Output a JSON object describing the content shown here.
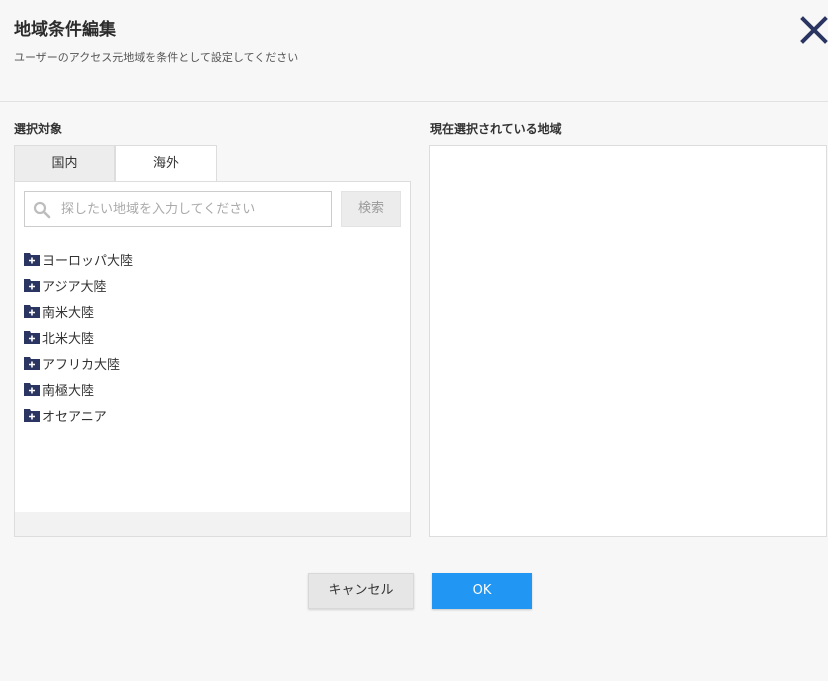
{
  "dialog": {
    "title": "地域条件編集",
    "subtitle": "ユーザーのアクセス元地域を条件として設定してください",
    "close_icon": "close-icon"
  },
  "left": {
    "label": "選択対象",
    "tabs": [
      {
        "label": "国内",
        "active": false
      },
      {
        "label": "海外",
        "active": true
      }
    ],
    "search": {
      "placeholder": "探したい地域を入力してください",
      "value": "",
      "button_label": "検索"
    },
    "tree": [
      {
        "label": "ヨーロッパ大陸",
        "icon": "folder-plus-icon"
      },
      {
        "label": "アジア大陸",
        "icon": "folder-plus-icon"
      },
      {
        "label": "南米大陸",
        "icon": "folder-plus-icon"
      },
      {
        "label": "北米大陸",
        "icon": "folder-plus-icon"
      },
      {
        "label": "アフリカ大陸",
        "icon": "folder-plus-icon"
      },
      {
        "label": "南極大陸",
        "icon": "folder-plus-icon"
      },
      {
        "label": "オセアニア",
        "icon": "folder-plus-icon"
      }
    ]
  },
  "right": {
    "label": "現在選択されている地域",
    "selected": []
  },
  "footer": {
    "cancel_label": "キャンセル",
    "ok_label": "OK"
  },
  "colors": {
    "accent": "#2196f3",
    "icon": "#2a3561"
  }
}
